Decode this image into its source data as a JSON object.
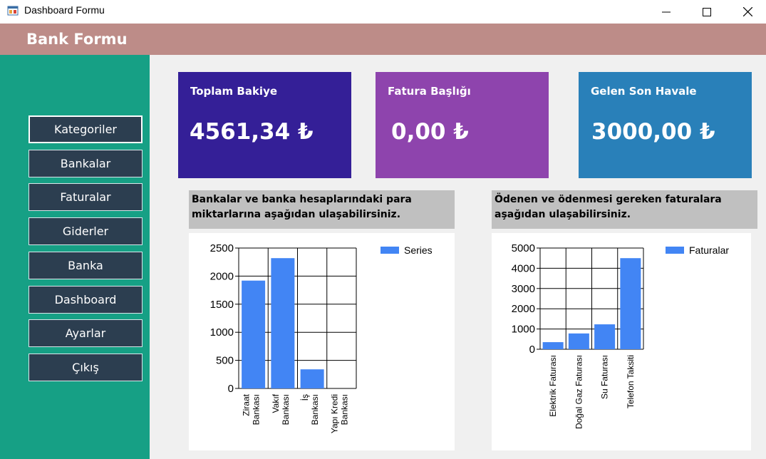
{
  "window": {
    "title": "Dashboard Formu"
  },
  "header": {
    "title": "Bank Formu"
  },
  "sidebar": {
    "items": [
      {
        "label": "Kategoriler"
      },
      {
        "label": "Bankalar"
      },
      {
        "label": "Faturalar"
      },
      {
        "label": "Giderler"
      },
      {
        "label": "Banka"
      },
      {
        "label": "Dashboard"
      },
      {
        "label": "Ayarlar"
      },
      {
        "label": "Çıkış"
      }
    ]
  },
  "cards": [
    {
      "label": "Toplam Bakiye",
      "value": "4561,34 ₺",
      "color": "#341f97"
    },
    {
      "label": "Fatura Başlığı",
      "value": "0,00 ₺",
      "color": "#8e44ad"
    },
    {
      "label": "Gelen Son Havale",
      "value": "3000,00 ₺",
      "color": "#2980b9"
    }
  ],
  "sections": {
    "banks_desc": "Bankalar ve banka hesaplarındaki para miktarlarına aşağıdan ulaşabilirsiniz.",
    "bills_desc": "Ödenen ve ödenmesi gereken faturalara aşağıdan ulaşabilirsiniz."
  },
  "chart_data": [
    {
      "type": "bar",
      "categories": [
        "Ziraat Bankası",
        "Vakıf Bankası",
        "İş Bankası",
        "Yapı Kredi Bankası"
      ],
      "series": [
        {
          "name": "Series",
          "values": [
            1920,
            2320,
            340,
            0
          ]
        }
      ],
      "ylim": [
        0,
        2500
      ],
      "yticks": [
        0,
        500,
        1000,
        1500,
        2000,
        2500
      ],
      "grid": true,
      "legend": "top-right",
      "color": "#4285f4"
    },
    {
      "type": "bar",
      "categories": [
        "Elektrik Faturası",
        "Doğal Gaz Faturası",
        "Su Faturası",
        "Telefon Taksiti"
      ],
      "series": [
        {
          "name": "Faturalar",
          "values": [
            350,
            780,
            1230,
            4500
          ]
        }
      ],
      "ylim": [
        0,
        5000
      ],
      "yticks": [
        0,
        1000,
        2000,
        3000,
        4000,
        5000
      ],
      "grid": true,
      "legend": "top-right",
      "color": "#4285f4"
    }
  ]
}
